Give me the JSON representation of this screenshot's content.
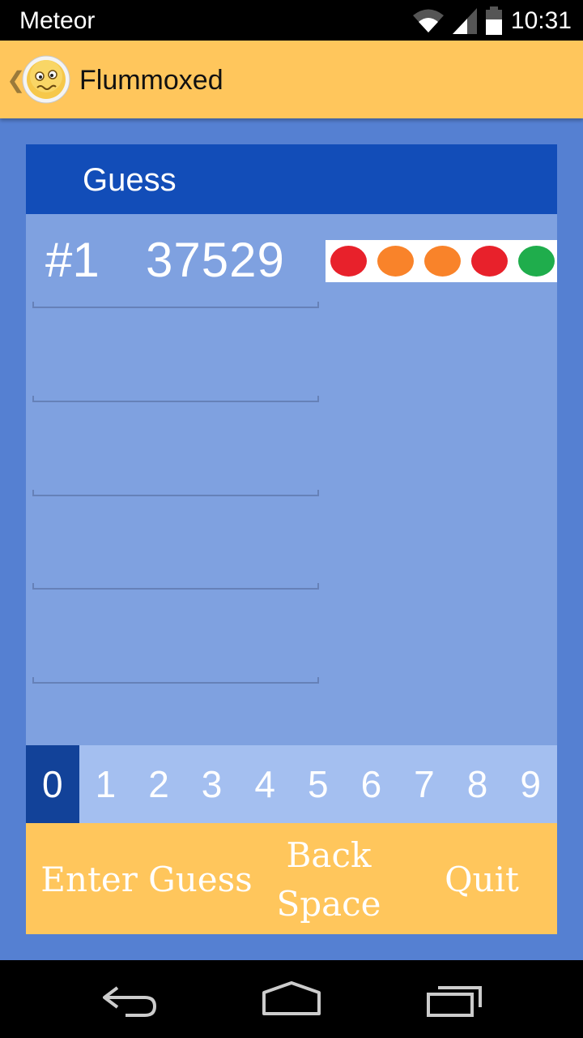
{
  "status_bar": {
    "carrier": "Meteor",
    "time": "10:31",
    "icons": [
      "wifi-icon",
      "signal-icon",
      "battery-icon"
    ]
  },
  "action_bar": {
    "title": "Flummoxed",
    "up_glyph": "❮",
    "icon": "confused-face-logo"
  },
  "board": {
    "header_label": "Guess",
    "guesses": [
      {
        "number": "#1",
        "value": "37529",
        "feedback": [
          "#e8212b",
          "#f9832a",
          "#f9832a",
          "#e8212b",
          "#1fad4c"
        ]
      },
      {
        "number": "",
        "value": ""
      },
      {
        "number": "",
        "value": ""
      },
      {
        "number": "",
        "value": ""
      },
      {
        "number": "",
        "value": ""
      }
    ],
    "digits": [
      "0",
      "1",
      "2",
      "3",
      "4",
      "5",
      "6",
      "7",
      "8",
      "9"
    ],
    "selected_digit": "0"
  },
  "buttons": {
    "enter_label": "Enter Guess",
    "back_line1": "Back",
    "back_line2": "Space",
    "quit_label": "Quit"
  },
  "colors": {
    "accent": "#ffc65c",
    "background": "#5580d2",
    "header": "#124db8",
    "panel": "#7fa1e0",
    "digit_bar": "#a4bff0",
    "digit_selected": "#124299"
  },
  "nav_bar": [
    "back-icon",
    "home-icon",
    "recents-icon"
  ]
}
